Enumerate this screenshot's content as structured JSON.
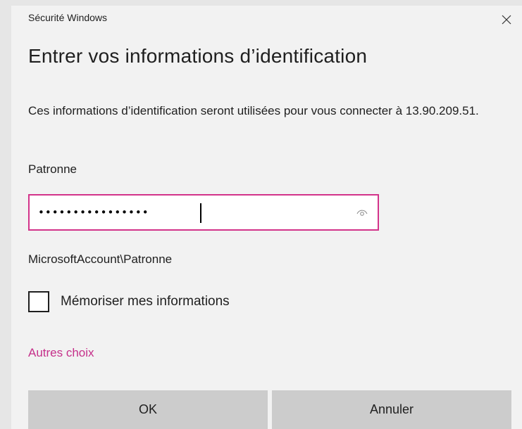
{
  "window": {
    "app_title": "Sécurité Windows",
    "close_icon": "close-icon"
  },
  "dialog": {
    "heading": "Entrer vos informations d’identification",
    "description": "Ces informations d’identification seront utilisées pour vous connecter à 13.90.209.51.",
    "username": "Patronne",
    "password_value": "••••••••••••••••",
    "reveal_icon": "eye-icon",
    "account": "MicrosoftAccount\\Patronne",
    "remember_label": "Mémoriser mes informations",
    "remember_checked": false,
    "more_choices": "Autres choix"
  },
  "buttons": {
    "ok": "OK",
    "cancel": "Annuler"
  },
  "colors": {
    "accent": "#d3338a",
    "link": "#c5308a",
    "background": "#f2f2f2",
    "button": "#cccccc"
  }
}
